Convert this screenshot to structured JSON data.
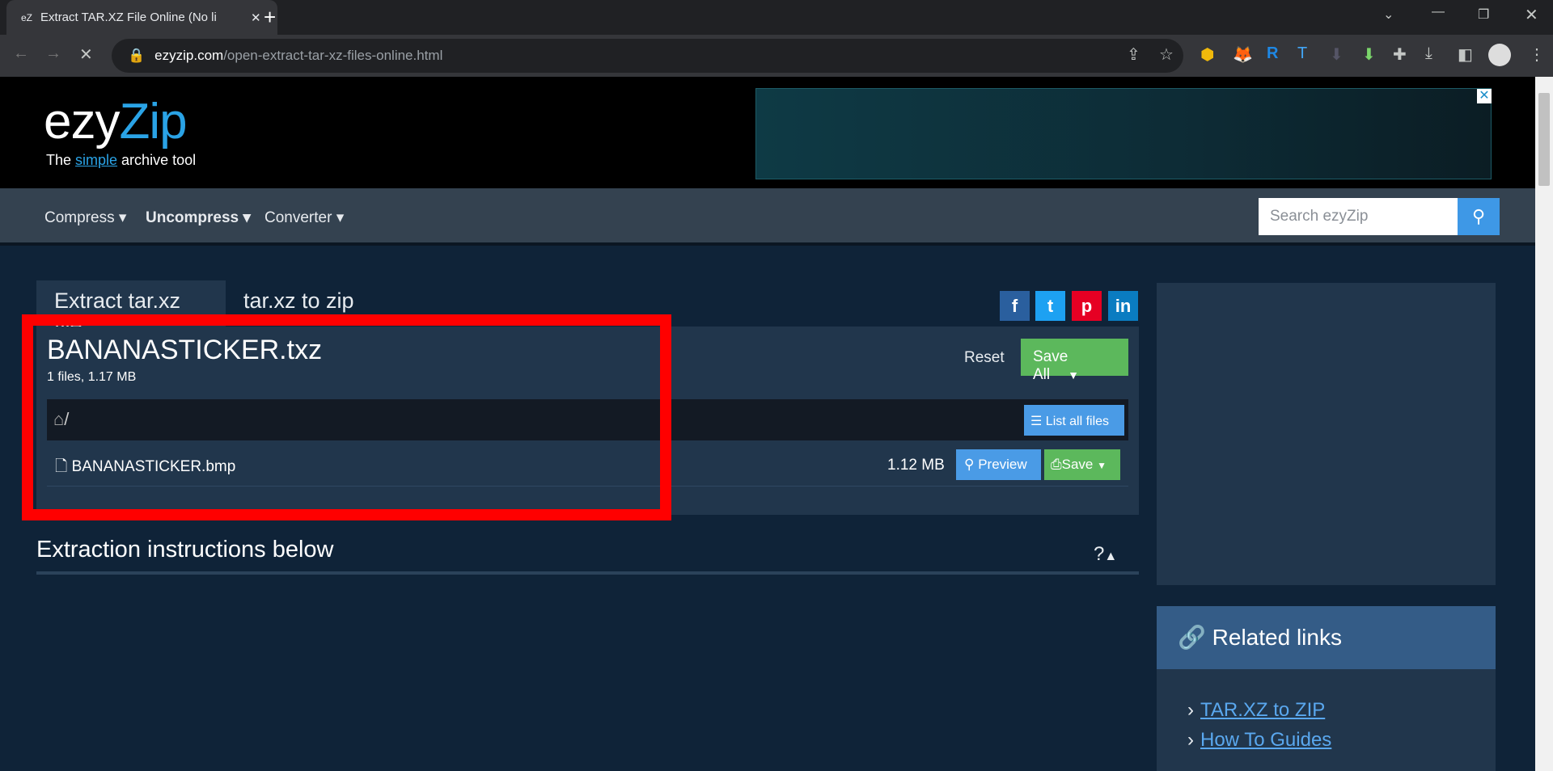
{
  "browser": {
    "tab_title": "Extract TAR.XZ File Online (No li",
    "url_domain": "ezyzip.com",
    "url_path": "/open-extract-tar-xz-files-online.html"
  },
  "header": {
    "logo_a": "ezy",
    "logo_b": "Zip",
    "tagline_a": "The ",
    "tagline_b": "simple",
    "tagline_c": " archive tool"
  },
  "nav": {
    "items": [
      "Compress",
      "Uncompress",
      "Converter"
    ],
    "search_placeholder": "Search ezyZip"
  },
  "tabs": [
    "Extract tar.xz file",
    "tar.xz to zip"
  ],
  "social": [
    "f",
    "t",
    "p",
    "in"
  ],
  "archive": {
    "name": "BANANASTICKER.txz",
    "meta": "1 files, 1.17 MB",
    "reset": "Reset",
    "save_all": "Save All",
    "path": "/",
    "list_all": "List all files",
    "files": [
      {
        "name": "BANANASTICKER.bmp",
        "size": "1.12 MB",
        "preview": "Preview",
        "save": "Save"
      }
    ]
  },
  "instructions": {
    "title": "Extraction instructions below",
    "toggle": "?"
  },
  "related": {
    "title": "Related links",
    "links": [
      "TAR.XZ to ZIP",
      "How To Guides"
    ]
  },
  "colors": {
    "highlight": "#ff0000",
    "save": "#5cb85c",
    "primary": "#4a9be6"
  }
}
